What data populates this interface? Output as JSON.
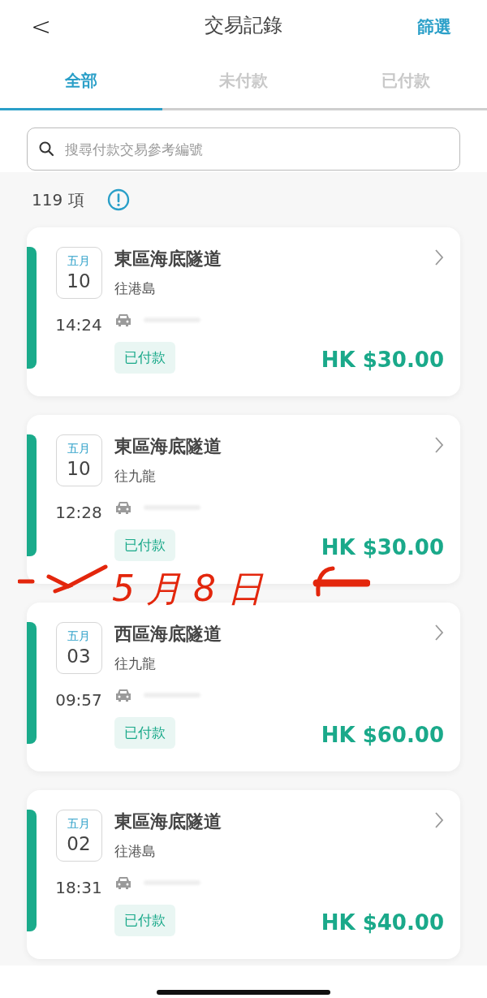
{
  "header": {
    "back": "<",
    "title": "交易記錄",
    "action": "篩選"
  },
  "tabs": [
    {
      "label": "全部",
      "selected": true
    },
    {
      "label": "未付款",
      "selected": false
    },
    {
      "label": "已付款",
      "selected": false
    }
  ],
  "search": {
    "placeholder": "搜尋付款交易參考編號"
  },
  "summary": {
    "count": "119 項"
  },
  "transactions": [
    {
      "month": "五月",
      "day": "10",
      "time": "14:24",
      "title": "東區海底隧道",
      "direction": "往港島",
      "status": "已付款",
      "amount": "HK $30.00"
    },
    {
      "month": "五月",
      "day": "10",
      "time": "12:28",
      "title": "東區海底隧道",
      "direction": "往九龍",
      "status": "已付款",
      "amount": "HK $30.00"
    },
    {
      "month": "五月",
      "day": "03",
      "time": "09:57",
      "title": "西區海底隧道",
      "direction": "往九龍",
      "status": "已付款",
      "amount": "HK $60.00"
    },
    {
      "month": "五月",
      "day": "02",
      "time": "18:31",
      "title": "東區海底隧道",
      "direction": "往港島",
      "status": "已付款",
      "amount": "HK $40.00"
    }
  ],
  "annotation": {
    "text": "5月8日"
  }
}
